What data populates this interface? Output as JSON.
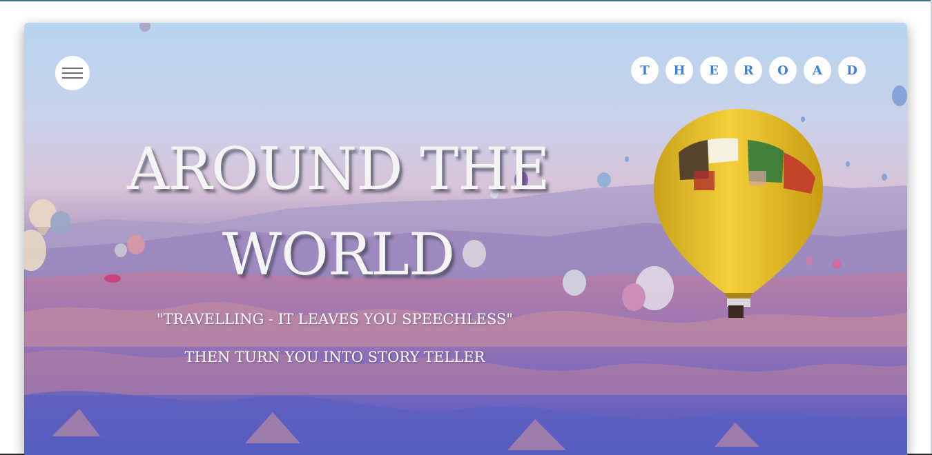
{
  "menu": {
    "icon": "hamburger-menu-icon"
  },
  "brand": {
    "letters": [
      "T",
      "H",
      "E",
      "R",
      "O",
      "A",
      "D"
    ],
    "color": "#3a7fd8"
  },
  "hero": {
    "headline_line1": "AROUND THE",
    "headline_line2": "WORLD",
    "quote": "\"TRAVELLING - IT LEAVES YOU SPEECHLESS\"",
    "tagline": "THEN TURN YOU INTO STORY TELLER",
    "background": "hot-air-balloons-over-valley"
  }
}
